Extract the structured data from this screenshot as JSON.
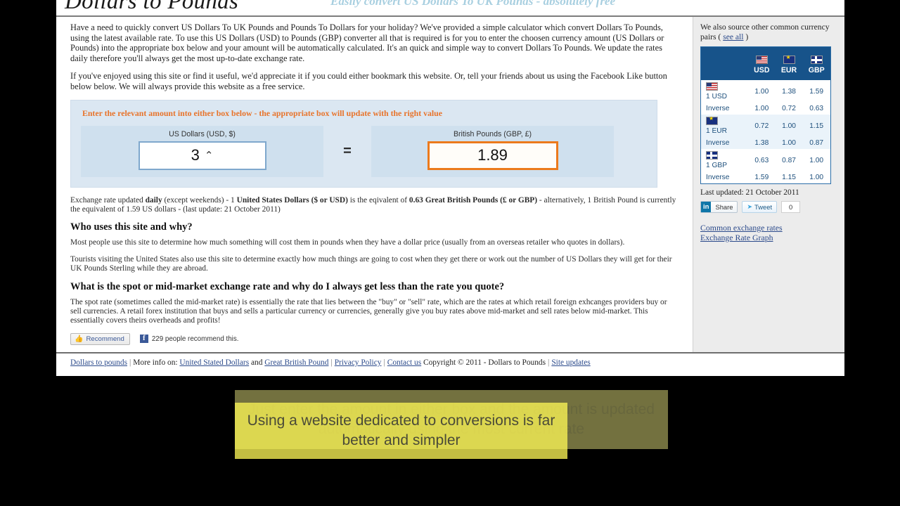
{
  "header": {
    "title": "Dollars to Pounds",
    "tagline": "Easily convert US Dollars To UK Pounds - absolutely free"
  },
  "intro": {
    "paragraph1": "Have a need to quickly convert US Dollars To UK Pounds and Pounds To Dollars for your holiday? We've provided a simple calculator which convert Dollars To Pounds, using the latest available rate. To use this US Dollars (USD) to Pounds (GBP) converter all that is required is for you to enter the choosen currency amount (US Dollars or Pounds) into the appropriate box below and your amount will be automatically calculated. It's an quick and simple way to convert Dollars To Pounds. We update the rates daily therefore you'll always get the most up-to-date exchange rate.",
    "paragraph2": "If you've enjoyed using this site or find it useful, we'd appreciate it if you could either bookmark this website. Or, tell your friends about us using the Facebook Like button below below. We will always provide this website as a free service."
  },
  "converter": {
    "instruction": "Enter the relevant amount into either box below - the appropriate box will update with the right value",
    "usd_label": "US Dollars (USD, $)",
    "usd_value": "3",
    "equals": "=",
    "gbp_label": "British Pounds (GBP, £)",
    "gbp_value": "1.89"
  },
  "rate_note": {
    "p1": "Exchange rate updated ",
    "b1": "daily",
    "p2": " (except weekends) - 1 ",
    "b2": "United States Dollars ($ or USD)",
    "p3": " is the eqivalent of ",
    "b3": "0.63 Great British Pounds (£ or GBP)",
    "p4": " - alternatively, 1 British Pound is currently the equivalent of 1.59 US dollars - (last update: 21 October 2011)"
  },
  "faq": [
    {
      "heading": "Who uses this site and why?",
      "paragraphs": [
        "Most people use this site to determine how much something will cost them in pounds when they have a dollar price (usually from an overseas retailer who quotes in dollars).",
        "Tourists visiting the United States also use this site to determine exactly how much things are going to cost when they get there or work out the number of US Dollars they will get for their UK Pounds Sterling while they are abroad."
      ]
    },
    {
      "heading": "What is the spot or mid-market exchange rate and why do I always get less than the rate you quote?",
      "paragraphs": [
        "The spot rate (sometimes called the mid-market rate) is essentially the rate that lies between the \"buy\" or \"sell\" rate, which are the rates at which retail foreign exhcanges providers buy or sell currencies. A retail forex institution that buys and sells a particular currency or currencies, generally give you buy rates above mid-market and sell rates below mid-market. This essentially covers theirs overheads and profits!"
      ]
    }
  ],
  "facebook": {
    "recommend_label": "Recommend",
    "count_text": "229 people recommend this."
  },
  "sidebar": {
    "intro_text": "We also source other common currency pairs ( ",
    "see_all": "see all",
    "intro_tail": " )",
    "table": {
      "columns": [
        "USD",
        "EUR",
        "GBP"
      ],
      "rows": [
        {
          "label": "1 USD",
          "flag": "us-flag-icon",
          "values": [
            "1.00",
            "1.38",
            "1.59"
          ]
        },
        {
          "label": "Inverse",
          "flag": "",
          "values": [
            "1.00",
            "0.72",
            "0.63"
          ]
        },
        {
          "label": "1 EUR",
          "flag": "eu-flag-icon",
          "values": [
            "0.72",
            "1.00",
            "1.15"
          ]
        },
        {
          "label": "Inverse",
          "flag": "",
          "values": [
            "1.38",
            "1.00",
            "0.87"
          ]
        },
        {
          "label": "1 GBP",
          "flag": "uk-flag-icon",
          "values": [
            "0.63",
            "0.87",
            "1.00"
          ]
        },
        {
          "label": "Inverse",
          "flag": "",
          "values": [
            "1.59",
            "1.15",
            "1.00"
          ]
        }
      ]
    },
    "last_updated": "Last updated: 21 October 2011",
    "linkedin_share": "Share",
    "linkedin_badge": "in",
    "tweet_label": "Tweet",
    "tweet_count": "0",
    "links": [
      "Common exchange rates",
      "Exchange Rate Graph"
    ]
  },
  "footer": {
    "link_home": "Dollars to pounds",
    "more_info": "More info on:",
    "link_usd": "United Stated Dollars",
    "and": "and",
    "link_gbp": "Great British Pound",
    "link_privacy": "Privacy Policy",
    "link_contact": "Contact us",
    "copyright": "Copyright © 2011 - Dollars to Pounds",
    "link_updates": "Site updates"
  },
  "captions": {
    "previous": "Just enter the amount in either box and the amount is updated automatically using the most current rate",
    "current": "Using a website dedicated to conversions is far better and simpler"
  },
  "colors": {
    "accent_orange": "#ec7a1c",
    "panel_blue": "#dbe7f2",
    "table_header_blue": "#17538a",
    "link_blue": "#2b4a8b",
    "tagline_blue": "#a8cfe0",
    "caption_yellow": "#faf355"
  }
}
